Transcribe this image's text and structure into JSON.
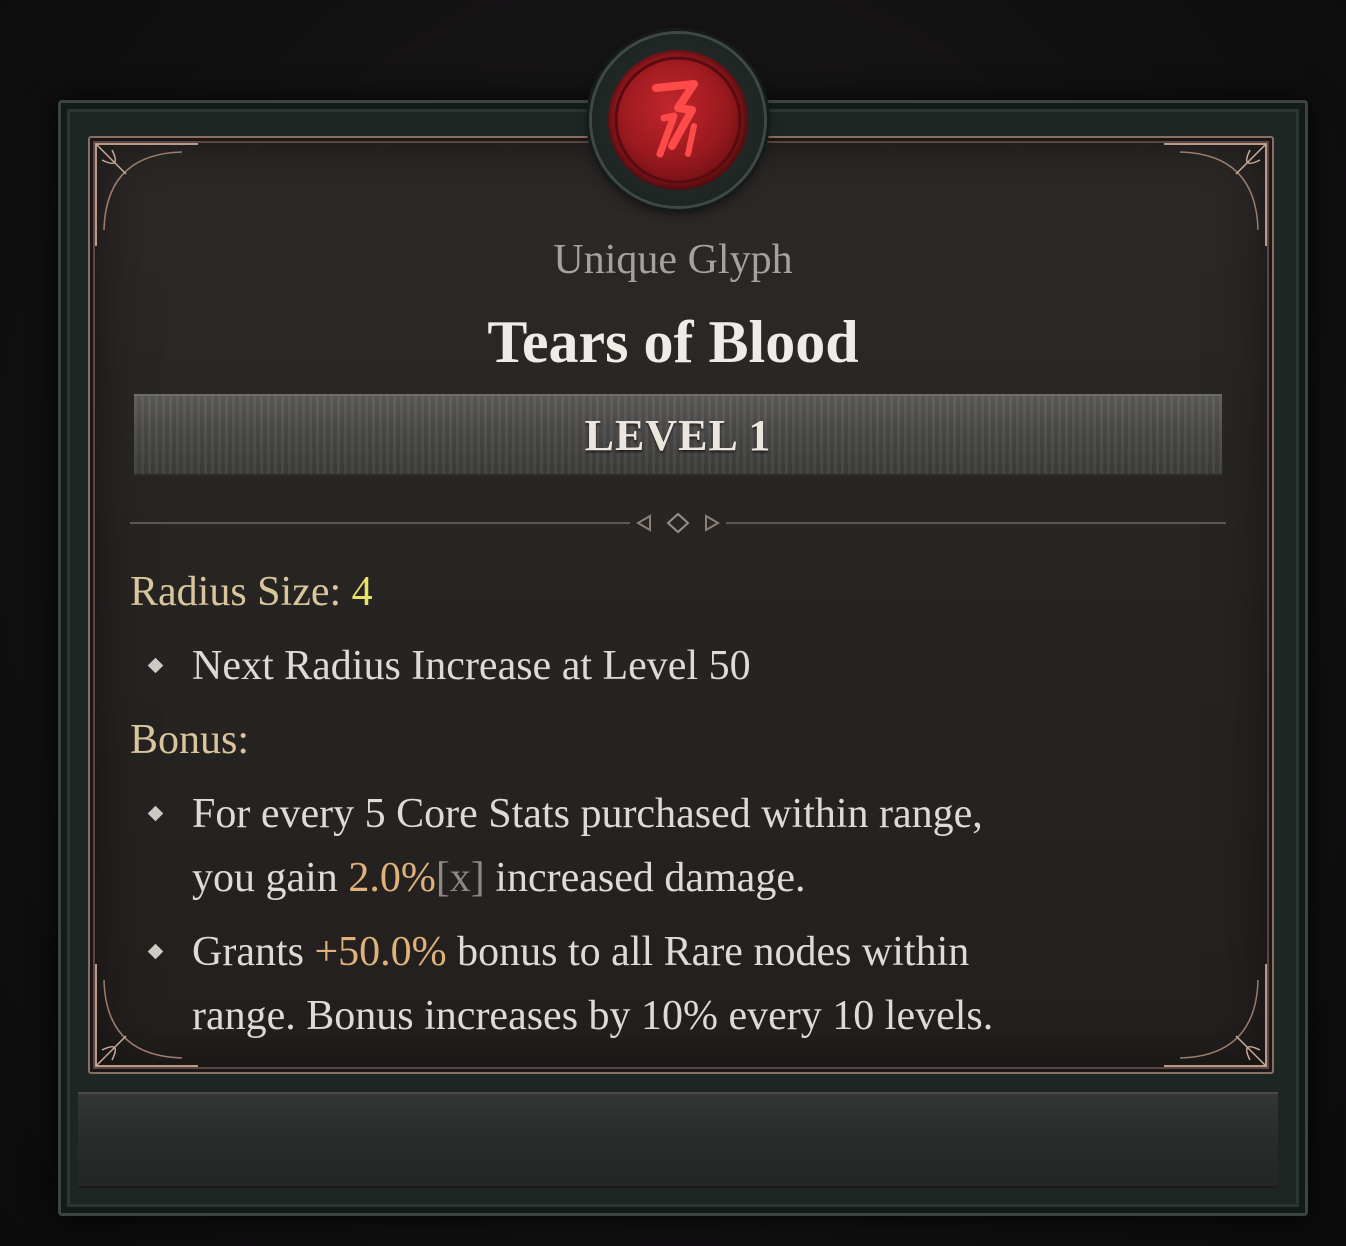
{
  "tooltip": {
    "emblem_icon": "blood-glyph-rune-icon",
    "rarity_type": "Unique Glyph",
    "name": "Tears of Blood",
    "level_label": "LEVEL 1",
    "radius": {
      "label": "Radius Size:",
      "value": "4",
      "next_increase": "Next Radius Increase at Level 50"
    },
    "bonus": {
      "label": "Bonus:",
      "line1_a": "For every 5 Core Stats purchased within range,",
      "line1_b_pre": "you gain ",
      "line1_b_value": "2.0%",
      "line1_b_tag": "[x]",
      "line1_b_post": " increased damage.",
      "line2_a_pre": "Grants ",
      "line2_a_value": "+50.0%",
      "line2_a_post": " bonus to all Rare nodes within",
      "line2_b": "range. Bonus increases by 10% every 10 levels."
    }
  },
  "colors": {
    "title": "#f0ebe6",
    "subtitle": "#a6a19e",
    "label_gold": "#d8c59c",
    "value_yellow": "#e8e26a",
    "value_orange": "#e0b27a",
    "emblem_red": "#9c1a20"
  }
}
